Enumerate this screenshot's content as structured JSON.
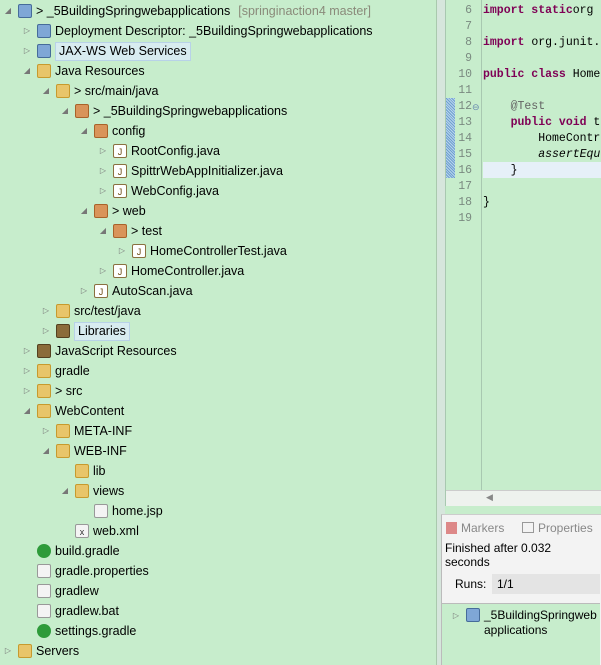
{
  "tree": [
    {
      "level": 0,
      "state": "expanded",
      "icon": "project-icon",
      "label": "> _5BuildingSpringwebapplications",
      "extra": "[springinaction4 master]"
    },
    {
      "level": 1,
      "state": "collapsed",
      "icon": "deployment-descriptor-icon",
      "label": "Deployment Descriptor: _5BuildingSpringwebapplications"
    },
    {
      "level": 1,
      "state": "collapsed",
      "icon": "web-services-icon",
      "label": "JAX-WS Web Services",
      "boxed": true
    },
    {
      "level": 1,
      "state": "expanded",
      "icon": "java-resources-icon",
      "label": "Java Resources"
    },
    {
      "level": 2,
      "state": "expanded",
      "icon": "source-folder-icon",
      "label": "> src/main/java"
    },
    {
      "level": 3,
      "state": "expanded",
      "icon": "package-icon",
      "label": "> _5BuildingSpringwebapplications"
    },
    {
      "level": 4,
      "state": "expanded",
      "icon": "package-icon",
      "label": "config"
    },
    {
      "level": 5,
      "state": "collapsed",
      "icon": "java-file-icon",
      "label": "RootConfig.java"
    },
    {
      "level": 5,
      "state": "collapsed",
      "icon": "java-file-icon",
      "label": "SpittrWebAppInitializer.java"
    },
    {
      "level": 5,
      "state": "collapsed",
      "icon": "java-file-icon",
      "label": "WebConfig.java"
    },
    {
      "level": 4,
      "state": "expanded",
      "icon": "package-icon",
      "label": "> web"
    },
    {
      "level": 5,
      "state": "expanded",
      "icon": "package-icon",
      "label": "> test"
    },
    {
      "level": 6,
      "state": "collapsed",
      "icon": "java-file-icon",
      "label": "HomeControllerTest.java"
    },
    {
      "level": 5,
      "state": "collapsed",
      "icon": "java-file-icon",
      "label": "HomeController.java"
    },
    {
      "level": 4,
      "state": "collapsed",
      "icon": "java-file-icon",
      "label": "AutoScan.java"
    },
    {
      "level": 2,
      "state": "collapsed",
      "icon": "source-folder-icon",
      "label": "src/test/java"
    },
    {
      "level": 2,
      "state": "collapsed",
      "icon": "library-icon",
      "label": "Libraries",
      "boxed": true
    },
    {
      "level": 1,
      "state": "collapsed",
      "icon": "javascript-resources-icon",
      "label": "JavaScript Resources"
    },
    {
      "level": 1,
      "state": "collapsed",
      "icon": "folder-icon",
      "label": "gradle"
    },
    {
      "level": 1,
      "state": "collapsed",
      "icon": "folder-icon",
      "label": "> src"
    },
    {
      "level": 1,
      "state": "expanded",
      "icon": "folder-icon",
      "label": "WebContent"
    },
    {
      "level": 2,
      "state": "collapsed",
      "icon": "folder-icon",
      "label": "META-INF"
    },
    {
      "level": 2,
      "state": "expanded",
      "icon": "folder-icon",
      "label": "WEB-INF"
    },
    {
      "level": 3,
      "state": "none",
      "icon": "folder-icon",
      "label": "lib"
    },
    {
      "level": 3,
      "state": "expanded",
      "icon": "folder-icon",
      "label": "views"
    },
    {
      "level": 4,
      "state": "none",
      "icon": "file-icon",
      "label": "home.jsp"
    },
    {
      "level": 3,
      "state": "none",
      "icon": "xml-file-icon",
      "label": "web.xml"
    },
    {
      "level": 1,
      "state": "none",
      "icon": "gradle-icon",
      "label": "build.gradle"
    },
    {
      "level": 1,
      "state": "none",
      "icon": "file-icon",
      "label": "gradle.properties"
    },
    {
      "level": 1,
      "state": "none",
      "icon": "file-icon",
      "label": "gradlew"
    },
    {
      "level": 1,
      "state": "none",
      "icon": "batch-file-icon",
      "label": "gradlew.bat"
    },
    {
      "level": 1,
      "state": "none",
      "icon": "gradle-icon",
      "label": "settings.gradle"
    },
    {
      "level": 0,
      "state": "collapsed",
      "icon": "servers-folder-icon",
      "label": "Servers"
    }
  ],
  "editor": {
    "lines": [
      {
        "n": "6",
        "parts": [
          [
            "kw",
            "import static"
          ],
          [
            "",
            "org"
          ]
        ]
      },
      {
        "n": "7",
        "parts": []
      },
      {
        "n": "8",
        "parts": [
          [
            "kw",
            "import"
          ],
          [
            "",
            " org.junit."
          ]
        ]
      },
      {
        "n": "9",
        "parts": []
      },
      {
        "n": "10",
        "parts": [
          [
            "kw",
            "public class"
          ],
          [
            "",
            " Home"
          ]
        ]
      },
      {
        "n": "11",
        "parts": []
      },
      {
        "n": "12",
        "parts": [
          [
            "ann",
            "    @Test"
          ]
        ]
      },
      {
        "n": "13",
        "parts": [
          [
            "kw",
            "    public void"
          ],
          [
            "",
            " t"
          ]
        ]
      },
      {
        "n": "14",
        "parts": [
          [
            "",
            "        HomeContr"
          ]
        ]
      },
      {
        "n": "15",
        "parts": [
          [
            "it",
            "        assertEqu"
          ]
        ]
      },
      {
        "n": "16",
        "parts": [
          [
            "",
            "    }"
          ]
        ]
      },
      {
        "n": "17",
        "parts": []
      },
      {
        "n": "18",
        "parts": [
          [
            "",
            "}"
          ]
        ]
      },
      {
        "n": "19",
        "parts": []
      }
    ]
  },
  "bottom": {
    "tabs": [
      "Markers",
      "Properties"
    ],
    "status": "Finished after 0.032 seconds",
    "runs_label": "Runs:",
    "runs_value": "1/1",
    "result": "_5BuildingSpringwebapplications"
  },
  "colors": {
    "background": "#c7edcc",
    "keyword": "#7f0055"
  }
}
